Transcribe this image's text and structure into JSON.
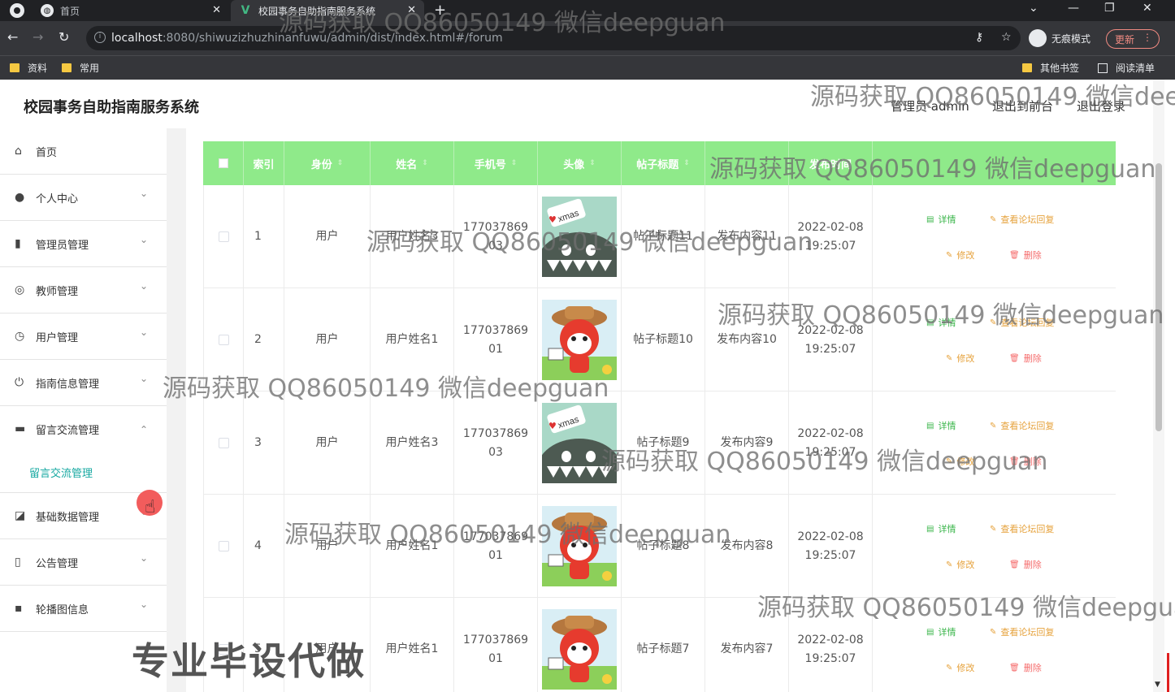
{
  "browser": {
    "tabs": [
      {
        "label": "首页",
        "icon": "globe-icon"
      },
      {
        "label": "校园事务自助指南服务系统",
        "icon": "vue-icon"
      }
    ],
    "url_host": "localhost",
    "url_rest": ":8080/shiwuzizhuzhinanfuwu/admin/dist/index.html#/forum",
    "incognito_label": "无痕模式",
    "update_label": "更新",
    "bookmarks": [
      "资料",
      "常用"
    ],
    "bookmarks_right": [
      "其他书签",
      "阅读清单"
    ]
  },
  "app": {
    "title": "校园事务自助指南服务系统",
    "header_links": [
      "管理员 admin",
      "退出到前台",
      "退出登录"
    ]
  },
  "sidebar": {
    "items": [
      {
        "label": "首页",
        "icon": "home-icon"
      },
      {
        "label": "个人中心",
        "icon": "user-icon"
      },
      {
        "label": "管理员管理",
        "icon": "chart-icon"
      },
      {
        "label": "教师管理",
        "icon": "compass-icon"
      },
      {
        "label": "用户管理",
        "icon": "clock-icon"
      },
      {
        "label": "指南信息管理",
        "icon": "power-icon"
      },
      {
        "label": "留言交流管理",
        "icon": "briefcase-icon"
      },
      {
        "label": "基础数据管理",
        "icon": "trend-icon"
      },
      {
        "label": "公告管理",
        "icon": "bar-chart-icon"
      },
      {
        "label": "轮播图信息",
        "icon": "message-icon"
      }
    ],
    "sub_item": "留言交流管理"
  },
  "table": {
    "headers": [
      "索引",
      "身份",
      "姓名",
      "手机号",
      "头像",
      "帖子标题",
      "",
      "发布时间"
    ],
    "rows": [
      {
        "index": "1",
        "role": "用户",
        "name": "用户姓名3",
        "phone1": "177037869",
        "phone2": "03",
        "avatar": "monster",
        "title": "帖子标题11",
        "content": "发布内容11",
        "date": "2022-02-08",
        "time": "19:25:07"
      },
      {
        "index": "2",
        "role": "用户",
        "name": "用户姓名1",
        "phone1": "177037869",
        "phone2": "01",
        "avatar": "fox",
        "title": "帖子标题10",
        "content": "发布内容10",
        "date": "2022-02-08",
        "time": "19:25:07"
      },
      {
        "index": "3",
        "role": "用户",
        "name": "用户姓名3",
        "phone1": "177037869",
        "phone2": "03",
        "avatar": "monster",
        "title": "帖子标题9",
        "content": "发布内容9",
        "date": "2022-02-08",
        "time": "19:25:07"
      },
      {
        "index": "4",
        "role": "用户",
        "name": "用户姓名1",
        "phone1": "177037869",
        "phone2": "01",
        "avatar": "fox",
        "title": "帖子标题8",
        "content": "发布内容8",
        "date": "2022-02-08",
        "time": "19:25:07"
      },
      {
        "index": "5",
        "role": "用户",
        "name": "用户姓名1",
        "phone1": "177037869",
        "phone2": "01",
        "avatar": "fox",
        "title": "帖子标题7",
        "content": "发布内容7",
        "date": "2022-02-08",
        "time": "19:25:07"
      }
    ],
    "ops": {
      "detail": "详情",
      "reply": "查看论坛回复",
      "edit": "修改",
      "delete": "删除"
    }
  },
  "watermark": "源码获取 QQ86050149 微信deepguan",
  "watermark_big": "专业毕设代做"
}
